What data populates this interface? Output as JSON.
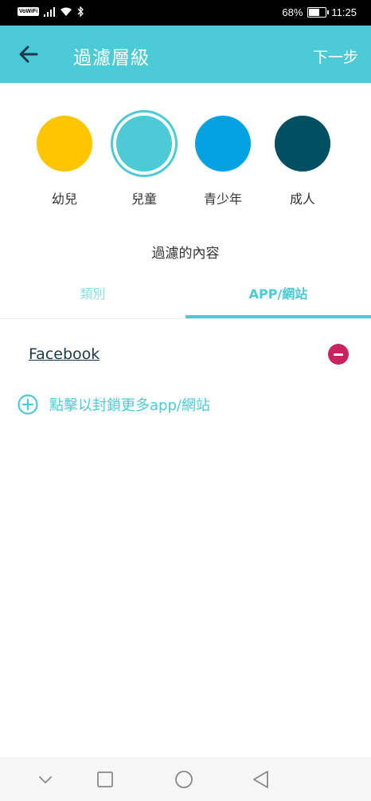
{
  "status_bar": {
    "carrier_badge": "VoWiFi",
    "battery_percent_text": "68%",
    "battery_level": 0.68,
    "time": "11:25"
  },
  "app_bar": {
    "title": "過濾層級",
    "next_label": "下一步",
    "accent_color": "#4ccad6"
  },
  "levels": [
    {
      "label": "幼兒",
      "color": "#ffc600",
      "selected": false
    },
    {
      "label": "兒童",
      "color": "#4ccad6",
      "selected": true
    },
    {
      "label": "青少年",
      "color": "#05a2e3",
      "selected": false
    },
    {
      "label": "成人",
      "color": "#004f63",
      "selected": false
    }
  ],
  "content_section": {
    "title": "過濾的內容",
    "tabs": [
      {
        "label": "類別",
        "active": false
      },
      {
        "label": "APP/網站",
        "active": true
      }
    ]
  },
  "blocked_list": {
    "items": [
      {
        "name": "Facebook"
      }
    ],
    "remove_color": "#c7235e",
    "add_label": "點擊以封鎖更多app/網站"
  },
  "nav_bar": {
    "icons": [
      "chevron-down-icon",
      "square-icon",
      "circle-icon",
      "triangle-back-icon"
    ]
  }
}
